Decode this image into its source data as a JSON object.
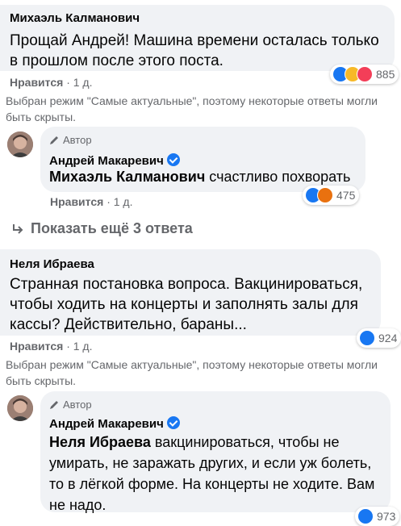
{
  "comment1": {
    "author": "Михаэль Калманович",
    "text": "Прощай Андрей! Машина времени осталась только в прошлом после этого поста.",
    "like": "Нравится",
    "time": "· 1 д.",
    "reactions": "885",
    "reaction_icons": [
      "like-icon",
      "haha-icon",
      "love-icon"
    ]
  },
  "note1": "Выбран режим \"Самые актуальные\", поэтому некоторые ответы могли быть скрыты.",
  "reply1": {
    "author_tag": "Автор",
    "author": "Андрей Макаревич",
    "mention": "Михаэль Калманович",
    "text": " счастливо похворать",
    "like": "Нравится",
    "time": "· 1 д.",
    "reactions": "475",
    "reaction_icons": [
      "like-icon",
      "angry-icon"
    ]
  },
  "show_more": "Показать ещё 3 ответа",
  "comment2": {
    "author": "Неля Ибраева",
    "text": "Странная постановка вопроса. Вакцинироваться, чтобы ходить на концерты и заполнять залы для кассы? Действительно, бараны...",
    "like": "Нравится",
    "time": "· 1 д.",
    "reactions": "924",
    "reaction_icons": [
      "like-icon"
    ]
  },
  "note2": "Выбран режим \"Самые актуальные\", поэтому некоторые ответы могли быть скрыты.",
  "reply2": {
    "author_tag": "Автор",
    "author": "Андрей Макаревич",
    "mention": "Неля Ибраева",
    "text": " вакцинироваться, чтобы не умирать, не заражать других, и если уж болеть, то в лёгкой форме. На концерты не ходите. Вам не надо.",
    "reactions": "973",
    "reaction_icons": [
      "like-icon"
    ]
  },
  "colors": {
    "bubble": "#f0f2f5",
    "like_blue": "#1877f2",
    "secondary_text": "#65676b",
    "love_red": "#f33e58",
    "haha_yellow": "#f7b928",
    "angry_orange": "#e9710f"
  }
}
